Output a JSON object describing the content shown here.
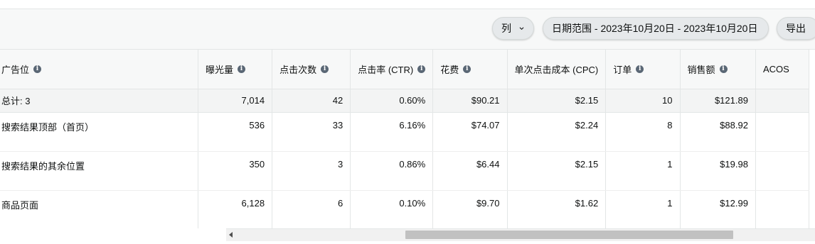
{
  "toolbar": {
    "columns_label": "列",
    "date_range_label": "日期范围 - 2023年10月20日 - 2023年10月20日",
    "export_label": "导出"
  },
  "table": {
    "headers": [
      "广告位",
      "曝光量",
      "点击次数",
      "点击率 (CTR)",
      "花费",
      "单次点击成本 (CPC)",
      "订单",
      "销售额",
      "ACOS"
    ],
    "total": [
      "总计: 3",
      "7,014",
      "42",
      "0.60%",
      "$90.21",
      "$2.15",
      "10",
      "$121.89",
      ""
    ],
    "rows": [
      [
        "搜索结果顶部（首页）",
        "536",
        "33",
        "6.16%",
        "$74.07",
        "$2.24",
        "8",
        "$88.92",
        ""
      ],
      [
        "搜索结果的其余位置",
        "350",
        "3",
        "0.86%",
        "$6.44",
        "$2.15",
        "1",
        "$19.98",
        ""
      ],
      [
        "商品页面",
        "6,128",
        "6",
        "0.10%",
        "$9.70",
        "$1.62",
        "1",
        "$12.99",
        ""
      ]
    ]
  }
}
